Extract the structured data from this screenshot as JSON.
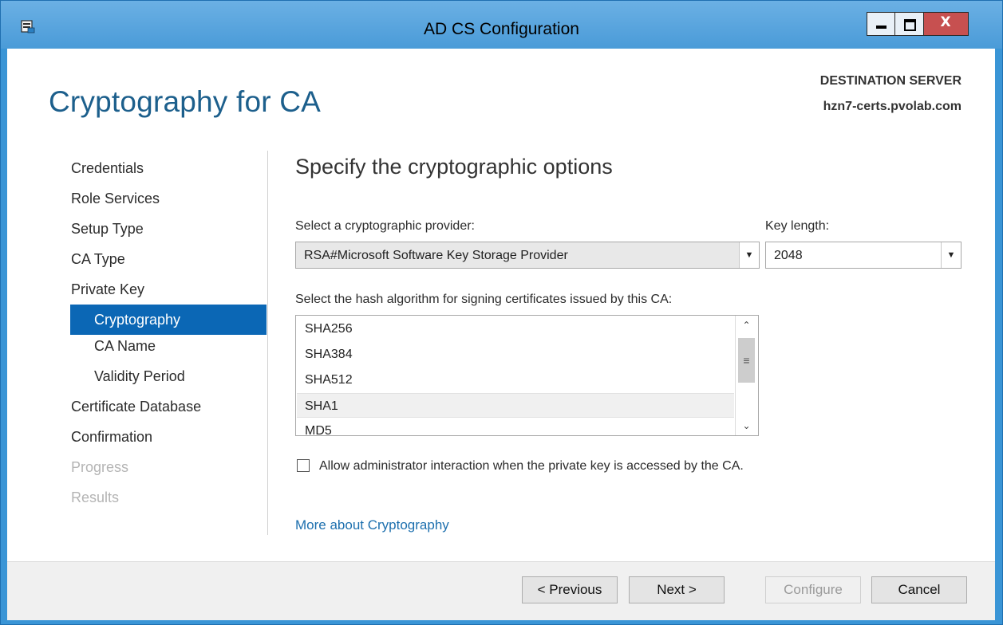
{
  "window": {
    "title": "AD CS Configuration",
    "controls": {
      "minimize": "minimize",
      "maximize": "maximize",
      "close": "X"
    }
  },
  "header": {
    "page_title": "Cryptography for CA",
    "destination_label": "DESTINATION SERVER",
    "destination_server": "hzn7-certs.pvolab.com"
  },
  "nav": {
    "items": [
      {
        "label": "Credentials",
        "state": "normal"
      },
      {
        "label": "Role Services",
        "state": "normal"
      },
      {
        "label": "Setup Type",
        "state": "normal"
      },
      {
        "label": "CA Type",
        "state": "normal"
      },
      {
        "label": "Private Key",
        "state": "normal"
      },
      {
        "label": "Cryptography",
        "state": "selected"
      },
      {
        "label": "CA Name",
        "state": "normal"
      },
      {
        "label": "Validity Period",
        "state": "normal"
      },
      {
        "label": "Certificate Database",
        "state": "normal"
      },
      {
        "label": "Confirmation",
        "state": "normal"
      },
      {
        "label": "Progress",
        "state": "disabled"
      },
      {
        "label": "Results",
        "state": "disabled"
      }
    ]
  },
  "main": {
    "section_title": "Specify the cryptographic options",
    "provider_label": "Select a cryptographic provider:",
    "provider_value": "RSA#Microsoft Software Key Storage Provider",
    "keylength_label": "Key length:",
    "keylength_value": "2048",
    "hash_label": "Select the hash algorithm for signing certificates issued by this CA:",
    "hash_options": [
      "SHA256",
      "SHA384",
      "SHA512",
      "SHA1",
      "MD5"
    ],
    "hash_highlighted": "SHA1",
    "allow_admin_label": "Allow administrator interaction when the private key is accessed by the CA.",
    "allow_admin_checked": false,
    "more_link": "More about Cryptography"
  },
  "footer": {
    "previous": "< Previous",
    "next": "Next >",
    "configure": "Configure",
    "cancel": "Cancel"
  },
  "colors": {
    "accent": "#0b67b5",
    "title_blue": "#1c5f8c",
    "link": "#1c6fae",
    "frame": "#3a95d6",
    "close_button": "#c75050"
  }
}
